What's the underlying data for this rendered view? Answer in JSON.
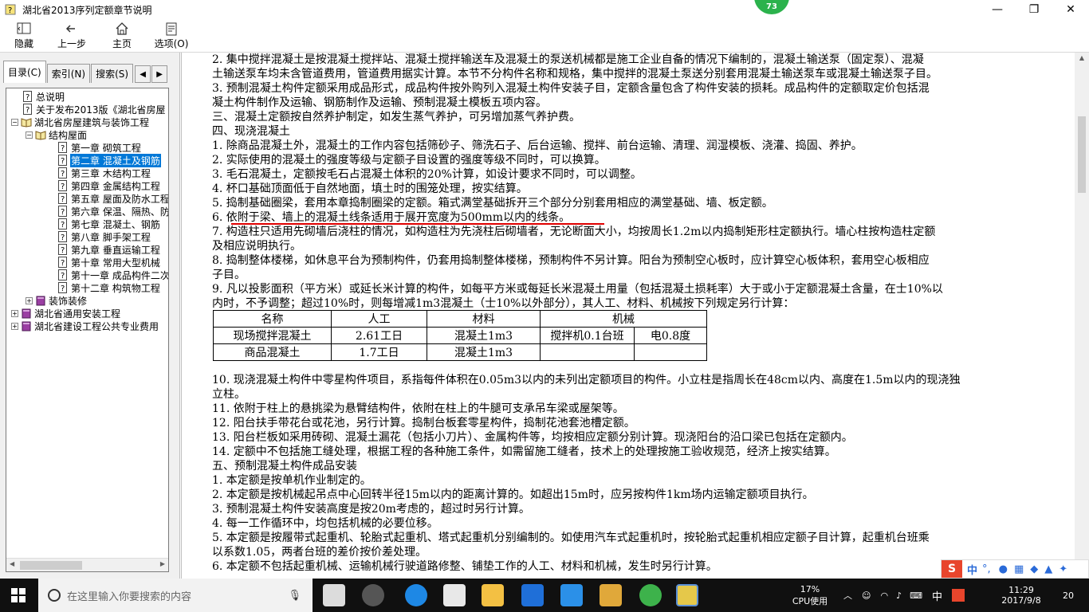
{
  "window": {
    "title": "湖北省2013序列定额章节说明",
    "badge": "73",
    "minimize": "—",
    "restore": "❐",
    "close": "✕"
  },
  "toolbar": {
    "hide": "隐藏",
    "back": "上一步",
    "home": "主页",
    "options": "选项(O)"
  },
  "tabs": {
    "contents": "目录(C)",
    "index": "索引(N)",
    "search": "搜索(S)"
  },
  "tree": [
    {
      "label": "总说明",
      "icon": "help-page-icon"
    },
    {
      "label": "关于发布2013版《湖北省房屋",
      "icon": "help-page-icon"
    },
    {
      "label": "湖北省房屋建筑与装饰工程",
      "icon": "book-open-icon",
      "exp": "−"
    },
    {
      "label": "结构屋面",
      "icon": "book-open-icon",
      "exp": "−"
    },
    {
      "label": "第一章 砌筑工程",
      "icon": "help-page-icon"
    },
    {
      "label": "第二章 混凝土及钢筋",
      "icon": "help-page-icon",
      "selected": true
    },
    {
      "label": "第三章 木结构工程",
      "icon": "help-page-icon"
    },
    {
      "label": "第四章 金属结构工程",
      "icon": "help-page-icon"
    },
    {
      "label": "第五章 屋面及防水工程",
      "icon": "help-page-icon"
    },
    {
      "label": "第六章 保温、隔热、防",
      "icon": "help-page-icon"
    },
    {
      "label": "第七章 混凝土、钢筋",
      "icon": "help-page-icon"
    },
    {
      "label": "第八章 脚手架工程",
      "icon": "help-page-icon"
    },
    {
      "label": "第九章 垂直运输工程",
      "icon": "help-page-icon"
    },
    {
      "label": "第十章 常用大型机械",
      "icon": "help-page-icon"
    },
    {
      "label": "第十一章 成品构件二次",
      "icon": "help-page-icon"
    },
    {
      "label": "第十二章 构筑物工程",
      "icon": "help-page-icon"
    },
    {
      "label": "装饰装修",
      "icon": "book-closed-icon",
      "exp": "+"
    },
    {
      "label": "湖北省通用安装工程",
      "icon": "book-closed-icon",
      "exp": "+"
    },
    {
      "label": "湖北省建设工程公共专业费用",
      "icon": "book-closed-icon",
      "exp": "+"
    }
  ],
  "content": {
    "lines_top": [
      "2. 集中搅拌混凝土是按混凝土搅拌站、混凝土搅拌输送车及混凝土的泵送机械都是施工企业自备的情况下编制的，混凝土输送泵（固定泵）、混凝",
      "土输送泵车均未含管道费用，管道费用据实计算。本节不分构件名称和规格，集中搅拌的混凝土泵送分别套用混凝土输送泵车或混凝土输送泵子目。",
      "3. 预制混凝土构件定额采用成品形式，成品构件按外购列入混凝土构件安装子目，定额含量包含了构件安装的损耗。成品构件的定额取定价包括混",
      "凝土构件制作及运输、钢筋制作及运输、预制混凝土模板五项内容。",
      "三、混凝土定额按自然养护制定，如发生蒸气养护，可另增加蒸气养护费。",
      "四、现浇混凝土",
      "1. 除商品混凝土外，混凝土的工作内容包括筛砂子、筛洗石子、后台运输、搅拌、前台运输、清理、润湿模板、浇灌、捣固、养护。",
      "2. 实际使用的混凝土的强度等级与定额子目设置的强度等级不同时，可以换算。",
      "3. 毛石混凝土，定额按毛石占混凝土体积的20%计算，如设计要求不同时，可以调整。",
      "4. 杯口基础顶面低于自然地面，填土时的围笼处理，按实结算。",
      "5. 捣制基础圈梁，套用本章捣制圈梁的定额。箱式满堂基础拆开三个部分分别套用相应的满堂基础、墙、板定额。",
      "6. 依附于梁、墙上的混凝土线条适用于展开宽度为500mm以内的线条。",
      "7. 构造柱只适用先砌墙后浇柱的情况，如构造柱为先浇柱后砌墙者，无论断面大小，均按周长1.2m以内捣制矩形柱定额执行。墙心柱按构造柱定额",
      "及相应说明执行。",
      "8. 捣制整体楼梯，如休息平台为预制构件，仍套用捣制整体楼梯，预制构件不另计算。阳台为预制空心板时，应计算空心板体积，套用空心板相应",
      "子目。",
      "9. 凡以投影面积（平方米）或延长米计算的构件，如每平方米或每延长米混凝土用量（包括混凝土损耗率）大于或小于定额混凝土含量，在士10%以",
      "内时，不予调整；超过10%时，则每增减1m3混凝土（士10%以外部分），其人工、材料、机械按下列规定另行计算："
    ],
    "table": {
      "headers": [
        "名称",
        "人工",
        "材料",
        "机械"
      ],
      "rows": [
        [
          "现场搅拌混凝土",
          "2.61工日",
          "混凝土1m3",
          "搅拌机0.1台班",
          "电0.8度"
        ],
        [
          "商品混凝土",
          "1.7工日",
          "混凝土1m3",
          "",
          ""
        ]
      ]
    },
    "lines_bottom": [
      "10. 现浇混凝土构件中零星构件项目，系指每件体积在0.05m3以内的未列出定额项目的构件。小立柱是指周长在48cm以内、高度在1.5m以内的现浇独",
      "立柱。",
      "11. 依附于柱上的悬挑梁为悬臂结构件，依附在柱上的牛腿可支承吊车梁或屋架等。",
      "12. 阳台扶手带花台或花池，另行计算。捣制台板套零星构件，捣制花池套池槽定额。",
      "13. 阳台栏板如采用砖砌、混凝土漏花（包括小刀片）、金属构件等，均按相应定额分别计算。现浇阳台的沿口梁已包括在定额内。",
      "14. 定额中不包括施工缝处理，根据工程的各种施工条件，如需留施工缝者，技术上的处理按施工验收规范，经济上按实结算。",
      "五、预制混凝土构件成品安装",
      "1. 本定额是按单机作业制定的。",
      "2. 本定额是按机械起吊点中心回转半径15m以内的距离计算的。如超出15m时，应另按构件1km场内运输定额项目执行。",
      "3. 预制混凝土构件安装高度是按20m考虑的，超过时另行计算。",
      "4. 每一工作循环中，均包括机械的必要位移。",
      "5. 本定额是按履带式起重机、轮胎式起重机、塔式起重机分别编制的。如使用汽车式起重机时，按轮胎式起重机相应定额子目计算，起重机台班乘",
      "以系数1.05，两者台班的差价按价差处理。",
      "6. 本定额不包括起重机械、运输机械行驶道路修整、铺垫工作的人工、材料和机械，发生时另行计算。"
    ]
  },
  "taskbar": {
    "search_placeholder": "在这里输入你要搜索的内容",
    "cpu_percent": "17%",
    "cpu_label": "CPU使用",
    "ime_lang": "中",
    "time": "11:29",
    "date": "2017/9/8",
    "notifications": "20"
  },
  "ime_bar": {
    "mode": "中",
    "punct": "°,"
  }
}
